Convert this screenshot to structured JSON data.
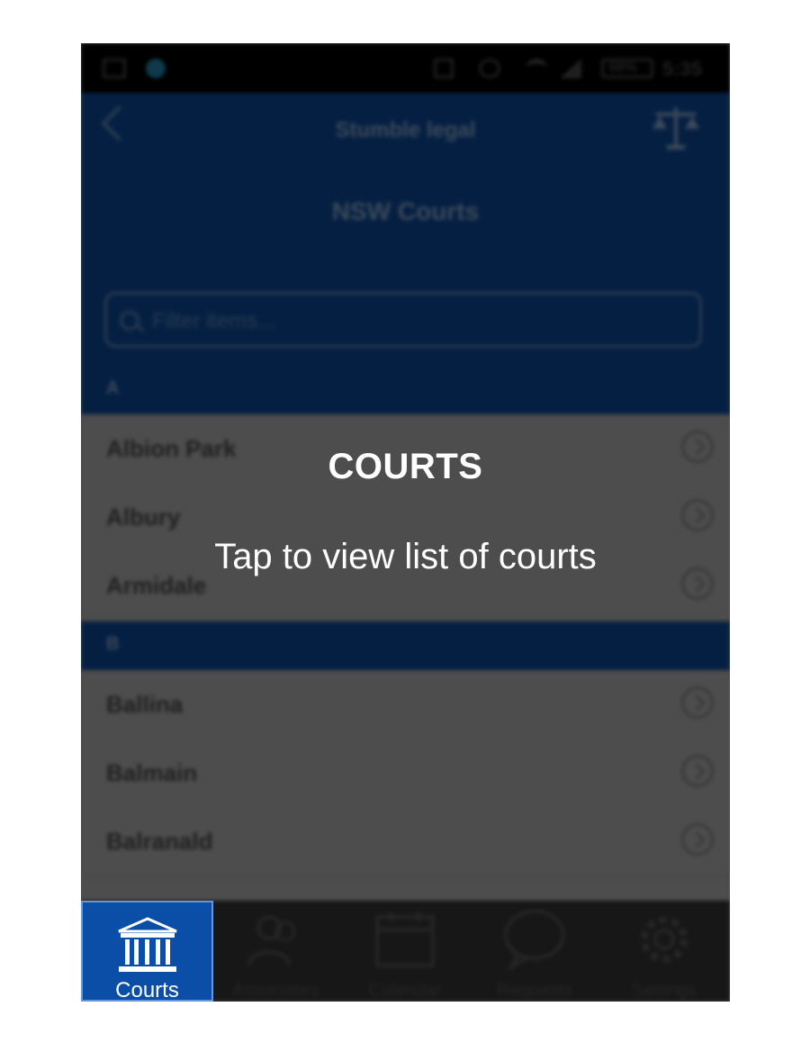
{
  "status_bar": {
    "battery": "98%",
    "time": "5:35"
  },
  "app_bar": {
    "app_title": "Stumble legal",
    "page_title": "NSW Courts"
  },
  "search": {
    "placeholder": "Filter items..."
  },
  "sections": [
    {
      "letter": "A",
      "items": [
        "Albion Park",
        "Albury",
        "Armidale"
      ]
    },
    {
      "letter": "B",
      "items": [
        "Ballina",
        "Balmain",
        "Balranald"
      ]
    }
  ],
  "tabs": [
    {
      "label": "Courts",
      "icon": "courthouse-icon",
      "active": true
    },
    {
      "label": "Associates",
      "icon": "people-icon",
      "active": false
    },
    {
      "label": "Calendar",
      "icon": "calendar-icon",
      "active": false
    },
    {
      "label": "Requests",
      "icon": "speech-bubble-icon",
      "active": false
    },
    {
      "label": "Settings",
      "icon": "gear-icon",
      "active": false
    }
  ],
  "coach": {
    "title": "COURTS",
    "body": "Tap to view list of courts"
  },
  "colors": {
    "brand_blue": "#0a3a7a",
    "active_tab": "#0a4ea8",
    "overlay": "rgba(0,0,0,0.45)"
  }
}
